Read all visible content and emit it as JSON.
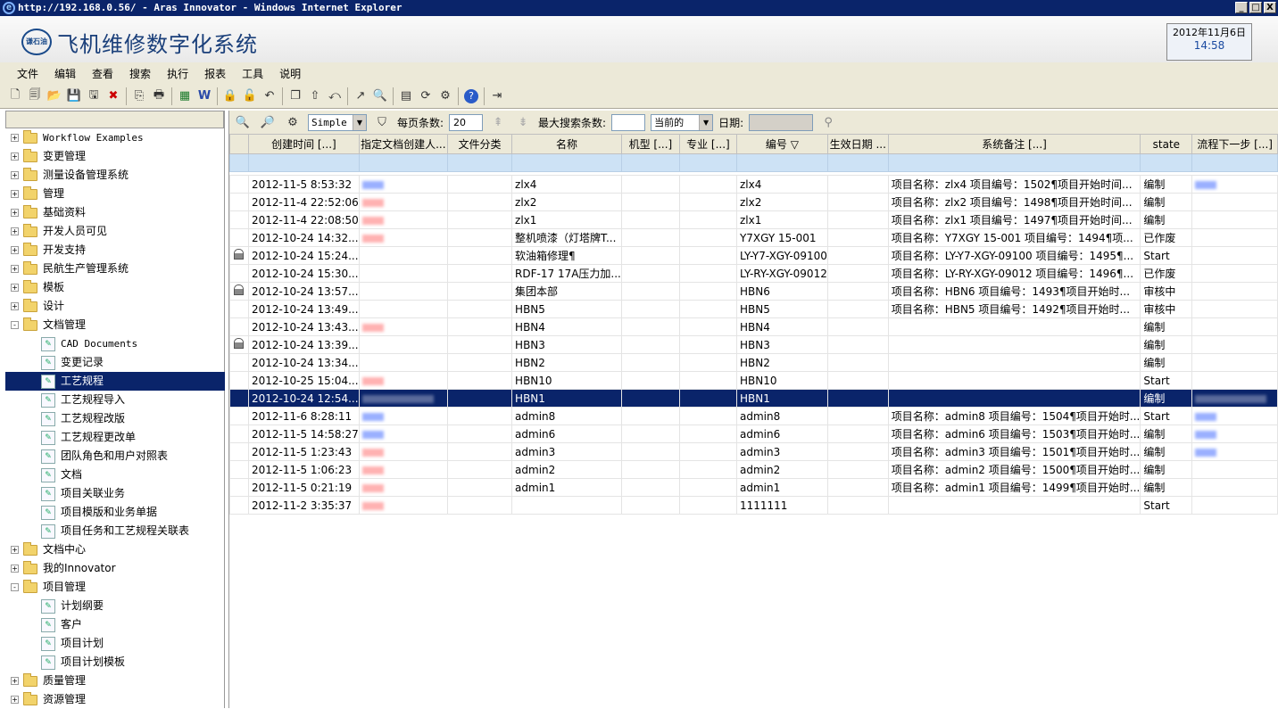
{
  "window": {
    "title": "http://192.168.0.56/ - Aras Innovator - Windows Internet Explorer",
    "min": "_",
    "max": "□",
    "close": "X"
  },
  "app": {
    "title": "飞机维修数字化系统",
    "logo_text": "谦石油",
    "date": "2012年11月6日",
    "time": "14:58"
  },
  "menu": [
    "文件",
    "编辑",
    "查看",
    "搜索",
    "执行",
    "报表",
    "工具",
    "说明"
  ],
  "toolbar_icons": [
    "new-doc-icon",
    "view-icon",
    "open-icon",
    "save-icon",
    "save-as-icon",
    "delete-icon",
    "copy-icon",
    "print-icon",
    "excel-icon",
    "word-icon",
    "lock-icon",
    "unlock-icon",
    "undo-icon",
    "clone-icon",
    "promote-icon",
    "revert-icon",
    "share-icon",
    "where-used-icon",
    "report-icon",
    "sync-icon",
    "settings-icon",
    "help-icon",
    "exit-icon"
  ],
  "tree": [
    {
      "label": "Workflow Examples",
      "level": 0,
      "exp": "+",
      "mono": true
    },
    {
      "label": "变更管理",
      "level": 0,
      "exp": "+"
    },
    {
      "label": "测量设备管理系统",
      "level": 0,
      "exp": "+"
    },
    {
      "label": "管理",
      "level": 0,
      "exp": "+"
    },
    {
      "label": "基础资料",
      "level": 0,
      "exp": "+"
    },
    {
      "label": "开发人员可见",
      "level": 0,
      "exp": "+"
    },
    {
      "label": "开发支持",
      "level": 0,
      "exp": "+"
    },
    {
      "label": "民航生产管理系统",
      "level": 0,
      "exp": "+"
    },
    {
      "label": "模板",
      "level": 0,
      "exp": "+"
    },
    {
      "label": "设计",
      "level": 0,
      "exp": "+"
    },
    {
      "label": "文档管理",
      "level": 0,
      "exp": "-"
    },
    {
      "label": "CAD Documents",
      "level": 1,
      "mono": true
    },
    {
      "label": "变更记录",
      "level": 1
    },
    {
      "label": "工艺规程",
      "level": 1,
      "selected": true
    },
    {
      "label": "工艺规程导入",
      "level": 1
    },
    {
      "label": "工艺规程改版",
      "level": 1
    },
    {
      "label": "工艺规程更改单",
      "level": 1
    },
    {
      "label": "团队角色和用户对照表",
      "level": 1
    },
    {
      "label": "文档",
      "level": 1
    },
    {
      "label": "项目关联业务",
      "level": 1
    },
    {
      "label": "项目模版和业务单据",
      "level": 1
    },
    {
      "label": "项目任务和工艺规程关联表",
      "level": 1
    },
    {
      "label": "文档中心",
      "level": 0,
      "exp": "+"
    },
    {
      "label": "我的Innovator",
      "level": 0,
      "exp": "+"
    },
    {
      "label": "项目管理",
      "level": 0,
      "exp": "-"
    },
    {
      "label": "计划纲要",
      "level": 1
    },
    {
      "label": "客户",
      "level": 1
    },
    {
      "label": "项目计划",
      "level": 1
    },
    {
      "label": "项目计划模板",
      "level": 1
    },
    {
      "label": "质量管理",
      "level": 0,
      "exp": "+"
    },
    {
      "label": "资源管理",
      "level": 0,
      "exp": "+"
    }
  ],
  "gridbar": {
    "mode": "Simple",
    "page_size_label": "每页条数:",
    "page_size": "20",
    "max_label": "最大搜索条数:",
    "max_value": "",
    "version": "当前的",
    "date_label": "日期:",
    "date_value": ""
  },
  "columns": [
    "",
    "创建时间 [...]",
    "指定文档创建人...",
    "文件分类",
    "名称",
    "机型 [...]",
    "专业 [...]",
    "编号",
    "生效日期 ...",
    "系统备注 [...]",
    "state",
    "流程下一步 [...]"
  ],
  "rows": [
    {
      "lock": false,
      "created": "2012-11-5 8:53:32",
      "creator": "b",
      "name": "zlx4",
      "code": "zlx4",
      "remark": "项目名称：zlx4 项目编号：1502¶项目开始时间...",
      "state": "编制",
      "next": "b"
    },
    {
      "lock": false,
      "created": "2012-11-4 22:52:06",
      "creator": "r",
      "name": "zlx2",
      "code": "zlx2",
      "remark": "项目名称：zlx2 项目编号：1498¶项目开始时间...",
      "state": "编制",
      "next": ""
    },
    {
      "lock": false,
      "created": "2012-11-4 22:08:50",
      "creator": "r",
      "name": "zlx1",
      "code": "zlx1",
      "remark": "项目名称：zlx1 项目编号：1497¶项目开始时间...",
      "state": "编制",
      "next": ""
    },
    {
      "lock": false,
      "created": "2012-10-24 14:32...",
      "creator": "r",
      "name": "整机喷漆（灯塔牌T...",
      "code": "Y7XGY 15-001",
      "remark": "项目名称：Y7XGY 15-001 项目编号：1494¶项...",
      "state": "已作废",
      "next": ""
    },
    {
      "lock": true,
      "created": "2012-10-24 15:24...",
      "creator": "",
      "name": "软油箱修理¶",
      "code": "LY-Y7-XGY-09100",
      "remark": "项目名称：LY-Y7-XGY-09100 项目编号：1495¶...",
      "state": "Start",
      "next": ""
    },
    {
      "lock": false,
      "created": "2012-10-24 15:30...",
      "creator": "",
      "name": "RDF-17 17A压力加...",
      "code": "LY-RY-XGY-09012",
      "remark": "项目名称：LY-RY-XGY-09012 项目编号：1496¶...",
      "state": "已作废",
      "next": ""
    },
    {
      "lock": true,
      "created": "2012-10-24 13:57...",
      "creator": "",
      "name": "集团本部",
      "code": "HBN6",
      "remark": "项目名称：HBN6 项目编号：1493¶项目开始时...",
      "state": "审核中",
      "next": ""
    },
    {
      "lock": false,
      "created": "2012-10-24 13:49...",
      "creator": "",
      "name": "HBN5",
      "code": "HBN5",
      "remark": "项目名称：HBN5 项目编号：1492¶项目开始时...",
      "state": "审核中",
      "next": ""
    },
    {
      "lock": false,
      "created": "2012-10-24 13:43...",
      "creator": "r",
      "name": "HBN4",
      "code": "HBN4",
      "remark": "",
      "state": "编制",
      "next": ""
    },
    {
      "lock": true,
      "created": "2012-10-24 13:39...",
      "creator": "",
      "name": "HBN3",
      "code": "HBN3",
      "remark": "",
      "state": "编制",
      "next": ""
    },
    {
      "lock": false,
      "created": "2012-10-24 13:34...",
      "creator": "",
      "name": "HBN2",
      "code": "HBN2",
      "remark": "",
      "state": "编制",
      "next": ""
    },
    {
      "lock": false,
      "created": "2012-10-25 15:04...",
      "creator": "r",
      "name": "HBN10",
      "code": "HBN10",
      "remark": "",
      "state": "Start",
      "next": ""
    },
    {
      "lock": false,
      "created": "2012-10-24 12:54...",
      "creator": "h",
      "name": "HBN1",
      "code": "HBN1",
      "remark": "",
      "state": "编制",
      "next": "h",
      "highlight": true
    },
    {
      "lock": false,
      "created": "2012-11-6 8:28:11",
      "creator": "b",
      "name": "admin8",
      "code": "admin8",
      "remark": "项目名称：admin8 项目编号：1504¶项目开始时...",
      "state": "Start",
      "next": "b"
    },
    {
      "lock": false,
      "created": "2012-11-5 14:58:27",
      "creator": "b",
      "name": "admin6",
      "code": "admin6",
      "remark": "项目名称：admin6 项目编号：1503¶项目开始时...",
      "state": "编制",
      "next": "b"
    },
    {
      "lock": false,
      "created": "2012-11-5 1:23:43",
      "creator": "r",
      "name": "admin3",
      "code": "admin3",
      "remark": "项目名称：admin3 项目编号：1501¶项目开始时...",
      "state": "编制",
      "next": "b"
    },
    {
      "lock": false,
      "created": "2012-11-5 1:06:23",
      "creator": "r",
      "name": "admin2",
      "code": "admin2",
      "remark": "项目名称：admin2 项目编号：1500¶项目开始时...",
      "state": "编制",
      "next": ""
    },
    {
      "lock": false,
      "created": "2012-11-5 0:21:19",
      "creator": "r",
      "name": "admin1",
      "code": "admin1",
      "remark": "项目名称：admin1 项目编号：1499¶项目开始时...",
      "state": "编制",
      "next": ""
    },
    {
      "lock": false,
      "created": "2012-11-2 3:35:37",
      "creator": "r",
      "name": "",
      "code": "1111111",
      "remark": "",
      "state": "Start",
      "next": ""
    }
  ]
}
